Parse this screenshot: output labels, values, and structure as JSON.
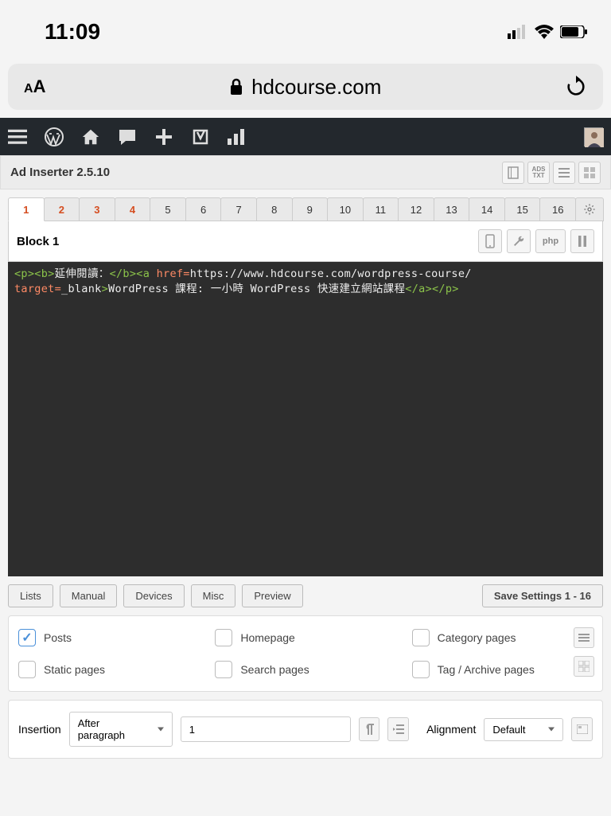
{
  "status": {
    "time": "11:09"
  },
  "browser": {
    "domain": "hdcourse.com"
  },
  "plugin": {
    "title": "Ad Inserter 2.5.10",
    "ads_txt": "ADS TXT"
  },
  "tabs": {
    "labels": [
      "1",
      "2",
      "3",
      "4",
      "5",
      "6",
      "7",
      "8",
      "9",
      "10",
      "11",
      "12",
      "13",
      "14",
      "15",
      "16"
    ],
    "active_index": 0,
    "red_indices": [
      0,
      1,
      2,
      3
    ]
  },
  "block": {
    "title": "Block 1",
    "php_label": "php"
  },
  "code": {
    "open1": "<p><b>",
    "text1": "延伸閱讀：",
    "close_b": "</b>",
    "a_open": "<a",
    "attr1": " href",
    "eq1": "=",
    "url": "https://www.hdcourse.com/wordpress-course/",
    "attr2": " target",
    "eq2": "=",
    "target": "_blank",
    "gt": ">",
    "linktext": "WordPress 課程: 一小時 WordPress 快速建立網站課程",
    "close": "</a></p>"
  },
  "buttons": {
    "lists": "Lists",
    "manual": "Manual",
    "devices": "Devices",
    "misc": "Misc",
    "preview": "Preview",
    "save": "Save Settings 1 - 16"
  },
  "checks": {
    "posts": {
      "label": "Posts",
      "checked": true
    },
    "homepage": {
      "label": "Homepage",
      "checked": false
    },
    "category": {
      "label": "Category pages",
      "checked": false
    },
    "static": {
      "label": "Static pages",
      "checked": false
    },
    "search": {
      "label": "Search pages",
      "checked": false
    },
    "tag": {
      "label": "Tag / Archive pages",
      "checked": false
    }
  },
  "insertion": {
    "label": "Insertion",
    "mode": "After paragraph",
    "value": "1",
    "alignment_label": "Alignment",
    "alignment": "Default"
  }
}
